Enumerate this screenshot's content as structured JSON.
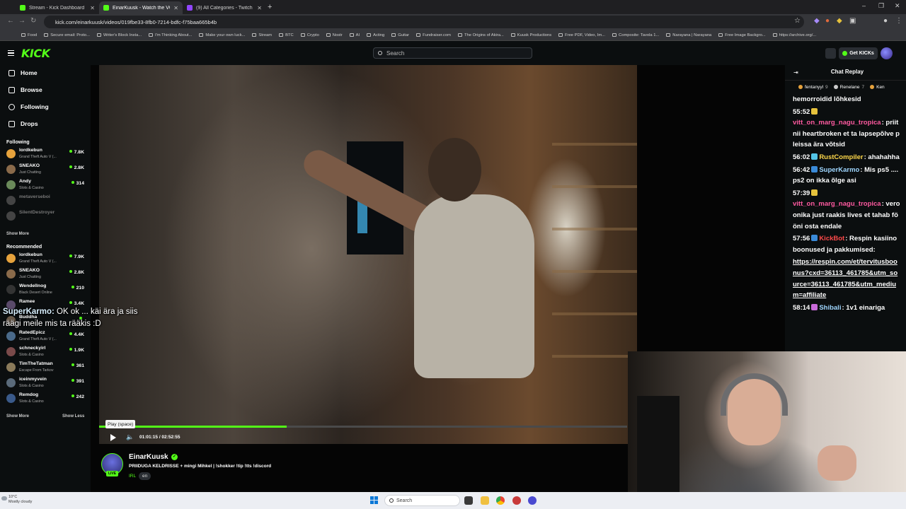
{
  "browser": {
    "tabs": [
      {
        "label": "Stream - Kick Dashboard",
        "active": false,
        "favicon_color": "#53fc18"
      },
      {
        "label": "EinarKuusk - Watch the VO",
        "active": true,
        "favicon_color": "#53fc18"
      },
      {
        "label": "(9) All Categories - Twitch",
        "active": false,
        "favicon_color": "#9146ff"
      }
    ],
    "new_tab_glyph": "+",
    "window_controls": [
      "–",
      "❐",
      "✕"
    ],
    "url": "kick.com/einarkuusk/videos/019fbe33-8fb0-7214-bdfc-f75baa665b4b",
    "bookmarks": [
      "Food",
      "Secure email: Proto...",
      "Writer's Block Insta...",
      "I'm Thinking About...",
      "Make your own luck...",
      "Stream",
      "BTC",
      "Crypto",
      "Nostr",
      "AI",
      "Acting",
      "Guitar",
      "Fundraiser.com",
      "The Origins of Akira...",
      "Kuusk Productions",
      "Free PDF, Video, Im...",
      "Composite: Tavola 1...",
      "Narayana | Narayana",
      "Free Image Backgro...",
      "https://archive.org/..."
    ]
  },
  "header": {
    "logo": "KICK",
    "search_placeholder": "Search",
    "get_kicks_label": "Get KICKs"
  },
  "sidebar": {
    "nav": [
      {
        "label": "Home"
      },
      {
        "label": "Browse"
      },
      {
        "label": "Following"
      },
      {
        "label": "Drops"
      }
    ],
    "following_title": "Following",
    "following": [
      {
        "name": "lordkebun",
        "game": "Grand Theft Auto V (...",
        "viewers": "7.8K",
        "online": true,
        "color": "#e6a23c"
      },
      {
        "name": "SNEAKO",
        "game": "Just Chatting",
        "viewers": "2.8K",
        "online": true,
        "color": "#8a6a4a"
      },
      {
        "name": "Andy",
        "game": "Slots & Casino",
        "viewers": "314",
        "online": true,
        "color": "#6a8a5a"
      },
      {
        "name": "metaverseboi",
        "game": "",
        "viewers": "",
        "online": false,
        "color": "#444"
      },
      {
        "name": "SilentDestroyer",
        "game": "",
        "viewers": "",
        "online": false,
        "color": "#444"
      }
    ],
    "show_more_1": "Show More",
    "recommended_title": "Recommended",
    "recommended": [
      {
        "name": "lordkebun",
        "game": "Grand Theft Auto V (...",
        "viewers": "7.9K",
        "color": "#e6a23c"
      },
      {
        "name": "SNEAKO",
        "game": "Just Chatting",
        "viewers": "2.8K",
        "color": "#8a6a4a"
      },
      {
        "name": "Wendellnog",
        "game": "Black Desert Online",
        "viewers": "210",
        "color": "#333"
      },
      {
        "name": "Ramee",
        "game": "",
        "viewers": "3.4K",
        "color": "#5a4a6a"
      },
      {
        "name": "Buddha",
        "game": "",
        "viewers": "",
        "color": "#6a5a4a"
      },
      {
        "name": "RatedEpicz",
        "game": "Grand Theft Auto V (...",
        "viewers": "4.4K",
        "color": "#4a6a8a"
      },
      {
        "name": "schneckyirl",
        "game": "Slots & Casino",
        "viewers": "1.9K",
        "color": "#7a4a4a"
      },
      {
        "name": "TimTheTatman",
        "game": "Escape From Tarkov",
        "viewers": "361",
        "color": "#8a7a5a"
      },
      {
        "name": "iceinmyvein",
        "game": "Slots & Casino",
        "viewers": "391",
        "color": "#5a6a7a"
      },
      {
        "name": "Remdog",
        "game": "Slots & Casino",
        "viewers": "242",
        "color": "#3a5a8a"
      }
    ],
    "show_more_2": "Show More",
    "show_less": "Show Less"
  },
  "player": {
    "caption_user": "SuperKarmo:",
    "caption_line1": " OK ok ... käi ära ja siis",
    "caption_line2": "räägi meile mis ta rääkis :D",
    "tooltip": "Play (space)",
    "timecode": "01:01:15 / 02:52:55",
    "progress": 0.355
  },
  "streamer": {
    "name": "EinarKuusk",
    "title": "PRIIDUGA KELDRISSE + mingi Mihkel | !shokker !tip !tts !discord",
    "category": "IRL",
    "language": "en",
    "live_badge": "LIVE"
  },
  "chat": {
    "title": "Chat Replay",
    "pinned": [
      {
        "name": "fentanyyl",
        "count": "9",
        "color": "#e6a23c"
      },
      {
        "name": "Renelane",
        "count": "7",
        "color": "#cccccc"
      },
      {
        "name": "Ken",
        "count": "",
        "color": "#e6a23c"
      }
    ],
    "messages": [
      {
        "time": "",
        "user": "",
        "user_color": "#fff",
        "text": "hemorroidid lõhkesid",
        "badge": ""
      },
      {
        "time": "55:52",
        "user": "vitt_on_marg_nagu_tropica",
        "user_color": "#ff5aa0",
        "text": ": priit nii heartbroken et ta lapsepõlve pleissa ära võtsid",
        "badge": "#e6c23c"
      },
      {
        "time": "56:02",
        "user": "RustCompiler",
        "user_color": "#ffd84a",
        "text": ": ahahahha",
        "badge": "#53c4e6"
      },
      {
        "time": "56:42",
        "user": "SuperKarmo",
        "user_color": "#9fd6ff",
        "text": ": Mis ps5 ....ps2 on ikka õlge asi",
        "badge": "#3a8ad8"
      },
      {
        "time": "57:39",
        "user": "vitt_on_marg_nagu_tropica",
        "user_color": "#ff5aa0",
        "text": ": veroonika just raakis lives et tahab fööni osta endale",
        "badge": "#e6c23c"
      },
      {
        "time": "57:56",
        "user": "KickBot",
        "user_color": "#ff4a4a",
        "text": ": Respin kasiino boonused ja pakkumised:",
        "badge": "#3a8ad8"
      },
      {
        "time": "",
        "user": "",
        "user_color": "#fff",
        "text": "https://respin.com/et/tervitusboonus?cxd=36113_461785&utm_source=36113_461785&utm_medium=affiliate",
        "badge": "",
        "is_link": true
      },
      {
        "time": "58:14",
        "user": "Shibali",
        "user_color": "#9fd6ff",
        "text": ": 1v1 einariga",
        "badge": "#c86ad8"
      }
    ]
  },
  "taskbar": {
    "weather_temp": "10°C",
    "weather_desc": "Mostly cloudy",
    "search_placeholder": "Search"
  }
}
